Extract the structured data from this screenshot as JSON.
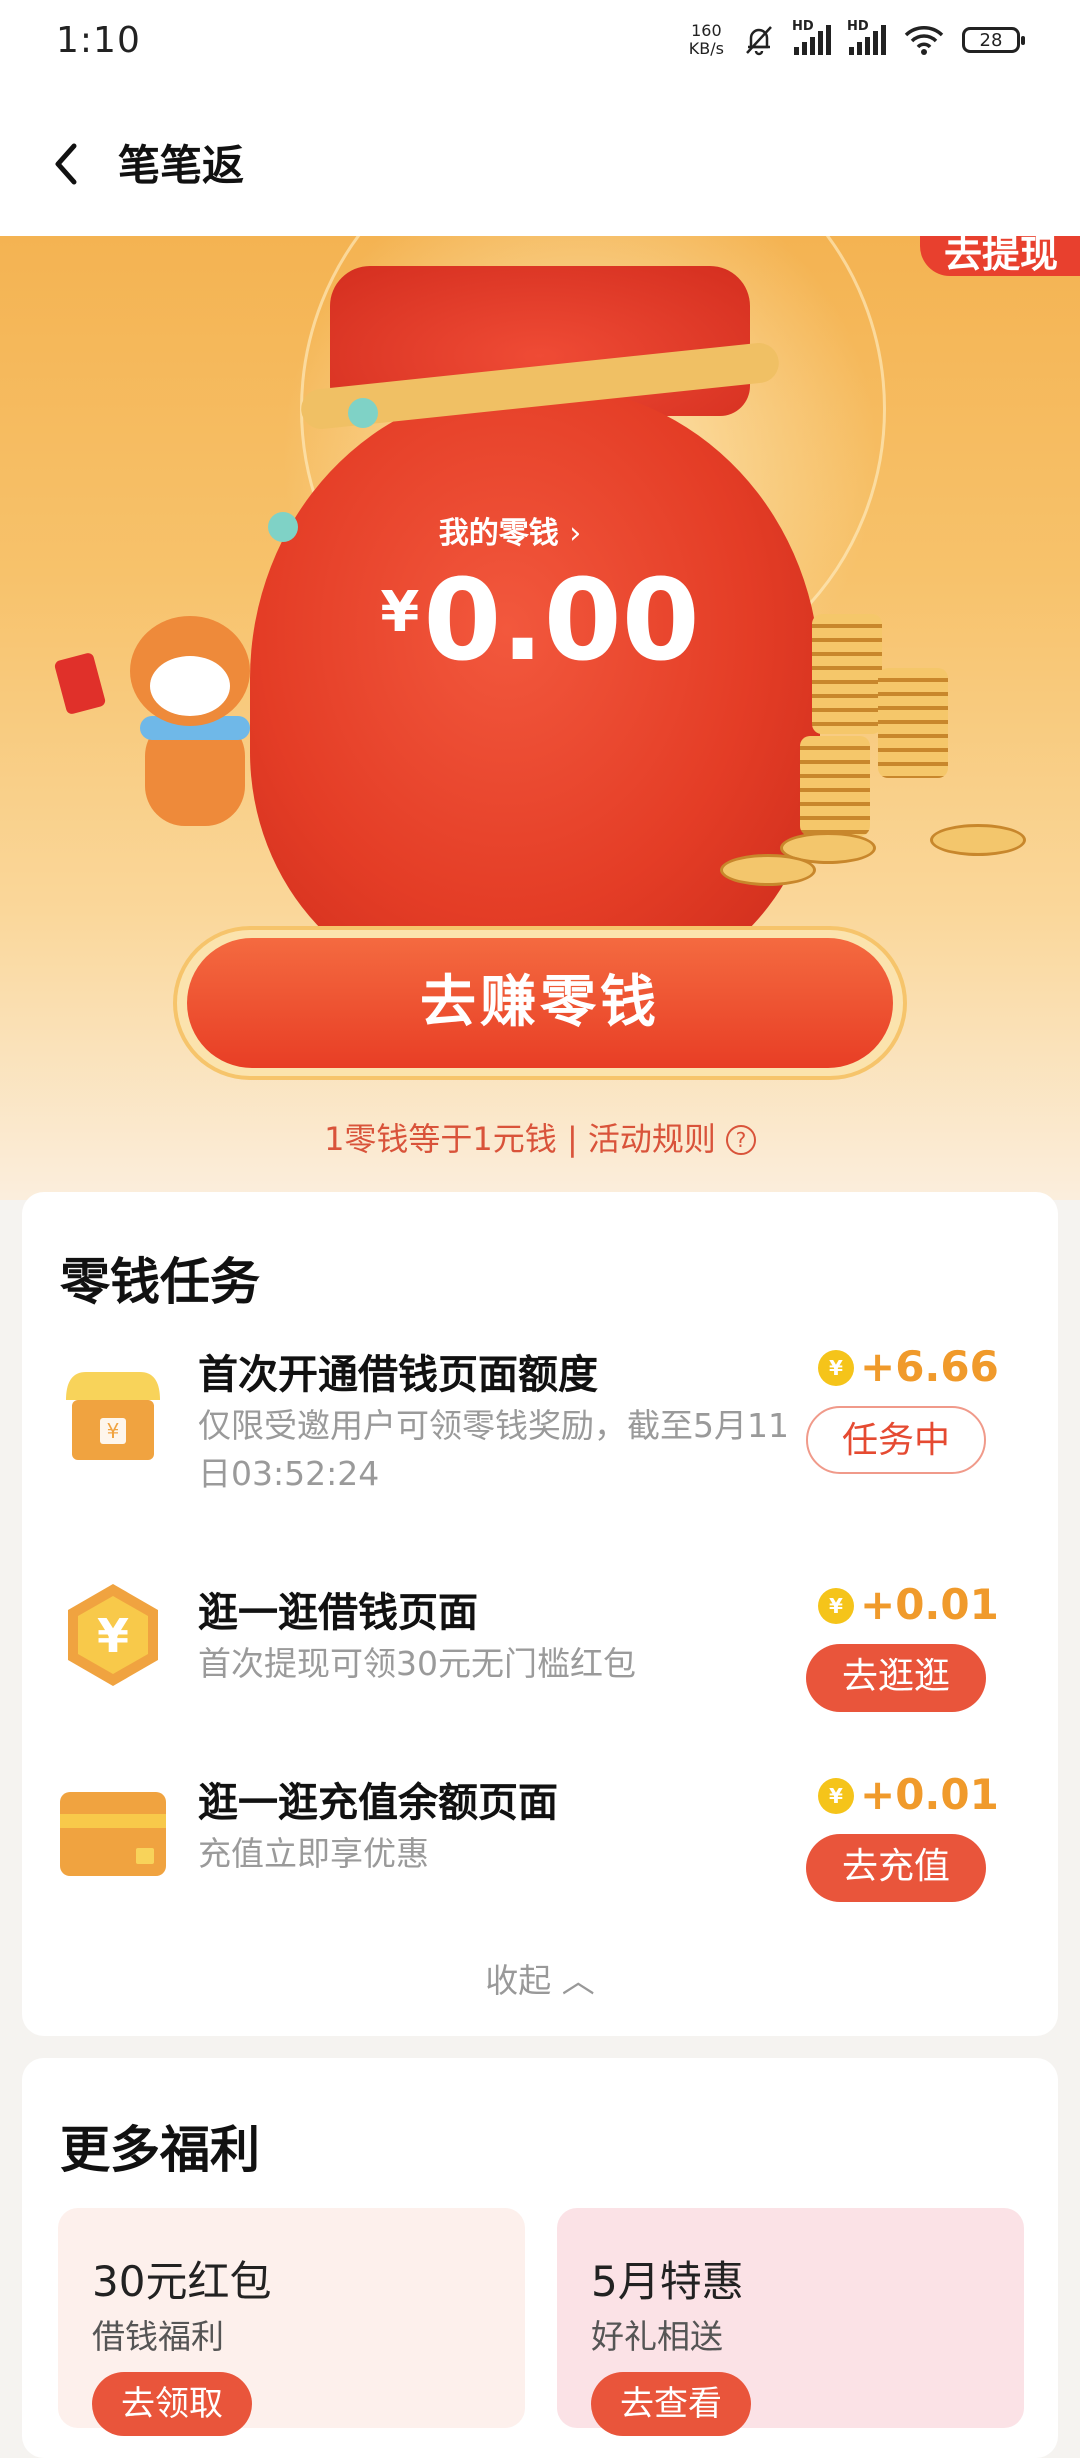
{
  "status_bar": {
    "time": "1:10",
    "net_speed_top": "160",
    "net_speed_bottom": "KB/s",
    "sim1": "HD",
    "sim2": "HD",
    "battery": "28"
  },
  "header": {
    "title": "笔笔返"
  },
  "hero": {
    "withdraw_label": "去提现",
    "wallet_label": "我的零钱",
    "currency": "¥",
    "amount": "0.00",
    "earn_button": "去赚零钱",
    "rule_text": "1零钱等于1元钱 | 活动规则"
  },
  "tasks": {
    "title": "零钱任务",
    "items": [
      {
        "title": "首次开通借钱页面额度",
        "desc": "仅限受邀用户可领零钱奖励，截至5月11日03:52:24",
        "reward": "+6.66",
        "button": "任务中",
        "icon": "shop-icon"
      },
      {
        "title": "逛一逛借钱页面",
        "desc": "首次提现可领30元无门槛红包",
        "reward": "+0.01",
        "button": "去逛逛",
        "icon": "yuan-hexagon-icon"
      },
      {
        "title": "逛一逛充值余额页面",
        "desc": "充值立即享优惠",
        "reward": "+0.01",
        "button": "去充值",
        "icon": "card-icon"
      }
    ],
    "collapse": "收起"
  },
  "more": {
    "title": "更多福利",
    "perks": [
      {
        "title": "30元红包",
        "sub": "借钱福利",
        "button": "去领取"
      },
      {
        "title": "5月特惠",
        "sub": "好礼相送",
        "button": "去查看"
      }
    ]
  },
  "colors": {
    "accent": "#e9553b",
    "reward": "#f09a2b",
    "hero_top": "#f4b352"
  }
}
